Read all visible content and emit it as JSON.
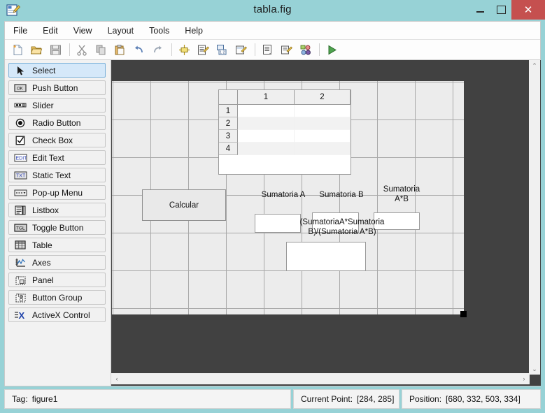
{
  "window": {
    "title": "tabla.fig",
    "icon": "guide-figure-icon",
    "minimize_label": "–",
    "maximize_label": "□",
    "close_label": "✕"
  },
  "menubar": {
    "items": [
      {
        "label": "File",
        "name": "menu-file"
      },
      {
        "label": "Edit",
        "name": "menu-edit"
      },
      {
        "label": "View",
        "name": "menu-view"
      },
      {
        "label": "Layout",
        "name": "menu-layout"
      },
      {
        "label": "Tools",
        "name": "menu-tools"
      },
      {
        "label": "Help",
        "name": "menu-help"
      }
    ]
  },
  "toolbar": {
    "buttons": [
      {
        "name": "new-figure-icon",
        "title": "New"
      },
      {
        "name": "open-folder-icon",
        "title": "Open"
      },
      {
        "name": "save-icon",
        "title": "Save"
      },
      {
        "name": "separator-1",
        "title": ""
      },
      {
        "name": "cut-icon",
        "title": "Cut"
      },
      {
        "name": "copy-icon",
        "title": "Copy"
      },
      {
        "name": "paste-icon",
        "title": "Paste"
      },
      {
        "name": "undo-icon",
        "title": "Undo"
      },
      {
        "name": "redo-icon",
        "title": "Redo"
      },
      {
        "name": "separator-2",
        "title": ""
      },
      {
        "name": "align-objects-icon",
        "title": "Align Objects"
      },
      {
        "name": "menu-editor-icon",
        "title": "Menu Editor"
      },
      {
        "name": "tab-order-editor-icon",
        "title": "Tab Order Editor"
      },
      {
        "name": "toolbar-editor-icon",
        "title": "Toolbar Editor"
      },
      {
        "name": "separator-3",
        "title": ""
      },
      {
        "name": "m-file-editor-icon",
        "title": "M-file Editor"
      },
      {
        "name": "property-inspector-icon",
        "title": "Property Inspector"
      },
      {
        "name": "object-browser-icon",
        "title": "Object Browser"
      },
      {
        "name": "separator-4",
        "title": ""
      },
      {
        "name": "run-icon",
        "title": "Run Figure"
      }
    ]
  },
  "palette": {
    "items": [
      {
        "label": "Select",
        "icon": "arrow-cursor-icon",
        "selected": true
      },
      {
        "label": "Push Button",
        "icon": "push-button-icon",
        "selected": false
      },
      {
        "label": "Slider",
        "icon": "slider-icon",
        "selected": false
      },
      {
        "label": "Radio Button",
        "icon": "radio-button-icon",
        "selected": false
      },
      {
        "label": "Check Box",
        "icon": "check-box-icon",
        "selected": false
      },
      {
        "label": "Edit Text",
        "icon": "edit-text-icon",
        "selected": false
      },
      {
        "label": "Static Text",
        "icon": "static-text-icon",
        "selected": false
      },
      {
        "label": "Pop-up Menu",
        "icon": "popup-menu-icon",
        "selected": false
      },
      {
        "label": "Listbox",
        "icon": "listbox-icon",
        "selected": false
      },
      {
        "label": "Toggle Button",
        "icon": "toggle-button-icon",
        "selected": false
      },
      {
        "label": "Table",
        "icon": "table-icon",
        "selected": false
      },
      {
        "label": "Axes",
        "icon": "axes-icon",
        "selected": false
      },
      {
        "label": "Panel",
        "icon": "panel-icon",
        "selected": false
      },
      {
        "label": "Button Group",
        "icon": "button-group-icon",
        "selected": false
      },
      {
        "label": "ActiveX Control",
        "icon": "activex-icon",
        "selected": false
      }
    ]
  },
  "figure": {
    "table": {
      "column_headers": [
        "1",
        "2"
      ],
      "row_headers": [
        "1",
        "2",
        "3",
        "4"
      ]
    },
    "calcular_button": {
      "label": "Calcular"
    },
    "labels": {
      "sumatoria_a": "Sumatoria A",
      "sumatoria_b": "Sumatoria B",
      "sumatoria_ab": "Sumatoria\nA*B",
      "ratio": "(SumatoriaA*Sumatoria\nB)/(Sumatoria A*B)"
    },
    "edit_fields": {
      "sumatoria_a_value": "",
      "sumatoria_b_value": "",
      "sumatoria_ab_value": "",
      "ratio_value": ""
    }
  },
  "scrollbars": {
    "v_up": "⌃",
    "v_down": "⌄",
    "h_left": "‹",
    "h_right": "›"
  },
  "statusbar": {
    "tag_label": "Tag:",
    "tag_value": "figure1",
    "current_point_label": "Current Point:",
    "current_point_value": "[284, 285]",
    "position_label": "Position:",
    "position_value": "[680, 332, 503, 334]"
  },
  "colors": {
    "titlebar": "#97d2d6",
    "close_button": "#c5504f",
    "selection": "#d5e8f9",
    "canvas_background": "#414141",
    "figure_background": "#ececec"
  }
}
